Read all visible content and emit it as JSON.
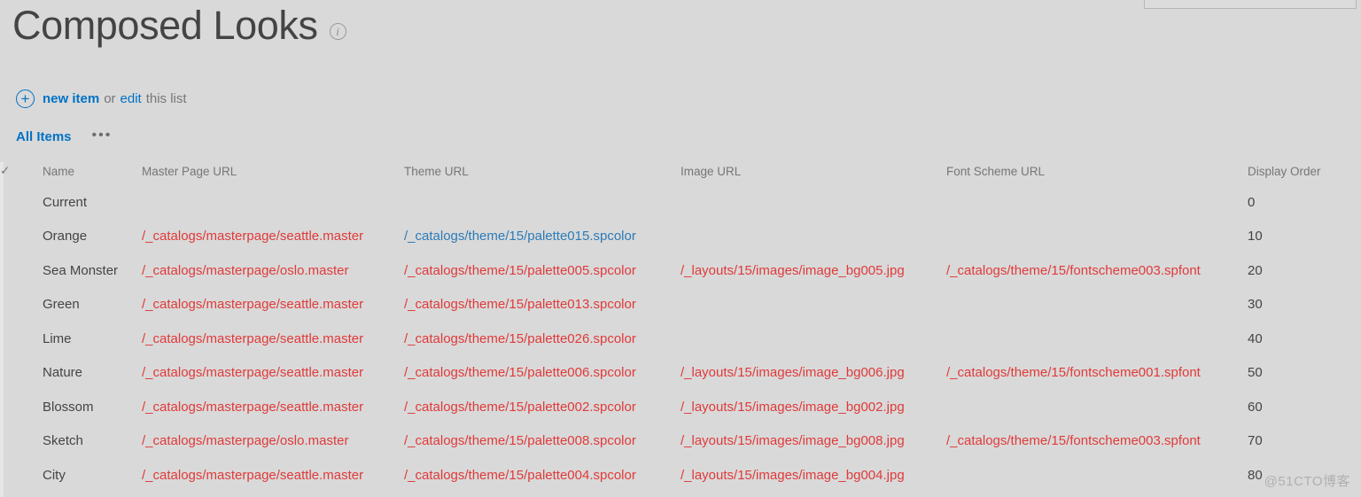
{
  "header": {
    "title": "Composed Looks",
    "info_icon": "info-icon"
  },
  "actions": {
    "plus_icon": "plus-circle-icon",
    "new_item_label": "new item",
    "or_label": "or",
    "edit_label": "edit",
    "this_list_label": "this list"
  },
  "views": {
    "current_view": "All Items",
    "ellipsis_label": "•••"
  },
  "table": {
    "select_all_icon": "✓",
    "columns": [
      "Name",
      "Master Page URL",
      "Theme URL",
      "Image URL",
      "Font Scheme URL",
      "Display Order"
    ],
    "rows": [
      {
        "name": "Current",
        "master_page_url": "",
        "theme_url": "",
        "image_url": "",
        "font_scheme_url": "",
        "display_order": "0",
        "theme_url_visited": false
      },
      {
        "name": "Orange",
        "master_page_url": "/_catalogs/masterpage/seattle.master",
        "theme_url": "/_catalogs/theme/15/palette015.spcolor",
        "image_url": "",
        "font_scheme_url": "",
        "display_order": "10",
        "theme_url_visited": true
      },
      {
        "name": "Sea Monster",
        "master_page_url": "/_catalogs/masterpage/oslo.master",
        "theme_url": "/_catalogs/theme/15/palette005.spcolor",
        "image_url": "/_layouts/15/images/image_bg005.jpg",
        "font_scheme_url": "/_catalogs/theme/15/fontscheme003.spfont",
        "display_order": "20",
        "theme_url_visited": false
      },
      {
        "name": "Green",
        "master_page_url": "/_catalogs/masterpage/seattle.master",
        "theme_url": "/_catalogs/theme/15/palette013.spcolor",
        "image_url": "",
        "font_scheme_url": "",
        "display_order": "30",
        "theme_url_visited": false
      },
      {
        "name": "Lime",
        "master_page_url": "/_catalogs/masterpage/seattle.master",
        "theme_url": "/_catalogs/theme/15/palette026.spcolor",
        "image_url": "",
        "font_scheme_url": "",
        "display_order": "40",
        "theme_url_visited": false
      },
      {
        "name": "Nature",
        "master_page_url": "/_catalogs/masterpage/seattle.master",
        "theme_url": "/_catalogs/theme/15/palette006.spcolor",
        "image_url": "/_layouts/15/images/image_bg006.jpg",
        "font_scheme_url": "/_catalogs/theme/15/fontscheme001.spfont",
        "display_order": "50",
        "theme_url_visited": false
      },
      {
        "name": "Blossom",
        "master_page_url": "/_catalogs/masterpage/seattle.master",
        "theme_url": "/_catalogs/theme/15/palette002.spcolor",
        "image_url": "/_layouts/15/images/image_bg002.jpg",
        "font_scheme_url": "",
        "display_order": "60",
        "theme_url_visited": false
      },
      {
        "name": "Sketch",
        "master_page_url": "/_catalogs/masterpage/oslo.master",
        "theme_url": "/_catalogs/theme/15/palette008.spcolor",
        "image_url": "/_layouts/15/images/image_bg008.jpg",
        "font_scheme_url": "/_catalogs/theme/15/fontscheme003.spfont",
        "display_order": "70",
        "theme_url_visited": false
      },
      {
        "name": "City",
        "master_page_url": "/_catalogs/masterpage/seattle.master",
        "theme_url": "/_catalogs/theme/15/palette004.spcolor",
        "image_url": "/_layouts/15/images/image_bg004.jpg",
        "font_scheme_url": "",
        "display_order": "80",
        "theme_url_visited": false
      }
    ]
  },
  "watermark": {
    "text": "@51CTO博客"
  },
  "colors": {
    "background": "#d9d9d9",
    "link_red": "#e03a3a",
    "link_blue": "#2b7bb9",
    "accent_blue": "#0072c6",
    "text_primary": "#444444",
    "text_muted": "#767676"
  }
}
